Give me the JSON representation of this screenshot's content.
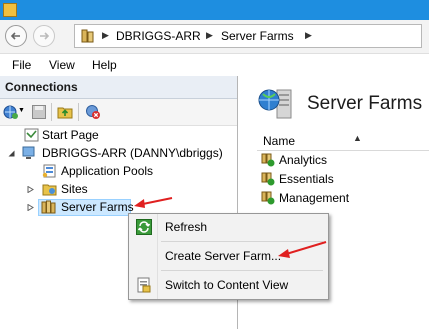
{
  "address_bar": {
    "crumbs": [
      "DBRIGGS-ARR",
      "Server Farms"
    ]
  },
  "menu": {
    "items": [
      "File",
      "View",
      "Help"
    ]
  },
  "connections": {
    "title": "Connections",
    "tree": {
      "start_page": "Start Page",
      "server": "DBRIGGS-ARR (DANNY\\dbriggs)",
      "app_pools": "Application Pools",
      "sites": "Sites",
      "server_farms": "Server Farms"
    }
  },
  "main": {
    "title": "Server Farms",
    "column_name": "Name",
    "farms": [
      "Analytics",
      "Essentials",
      "Management"
    ]
  },
  "context_menu": {
    "items": [
      "Refresh",
      "Create Server Farm...",
      "Switch to Content View"
    ]
  },
  "colors": {
    "titlebar": "#1e8ee0",
    "annotation_arrow": "#e02020",
    "selection": "#cce8ff"
  }
}
